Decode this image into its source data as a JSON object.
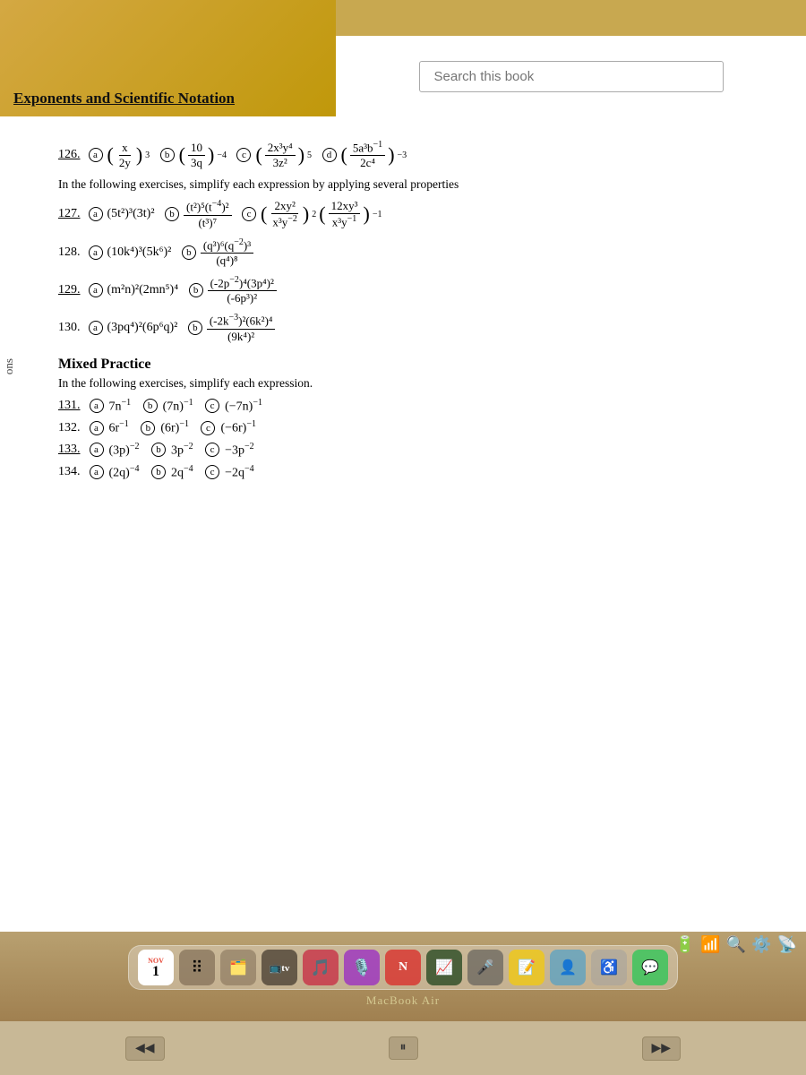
{
  "header": {
    "title": "Exponents and Scientific Notation",
    "search_placeholder": "Search this book"
  },
  "problem_126": {
    "number": "126.",
    "parts": {
      "a": "(x/2y)³",
      "b": "(10/3q)⁻⁴",
      "c": "(2x³y⁴/3z²)⁵",
      "d": "(5a³b⁻¹/2c⁴)⁻³"
    }
  },
  "instruction_1": "In the following exercises, simplify each expression by applying several properties",
  "problem_127": {
    "number": "127.",
    "parts": {
      "a": "(5t²)³(3t)²",
      "b": "(t²)⁵(t⁻⁴)² / (t³)⁷",
      "c": "(2xy²/x³y⁻²)² · (12xy³/x³y⁻¹)⁻¹"
    }
  },
  "problem_128": {
    "number": "128.",
    "parts": {
      "a": "(10k⁴)³(5k⁶)²",
      "b": "(q³)⁶(q⁻²)³ / (q⁴)⁸"
    }
  },
  "problem_129": {
    "number": "129.",
    "parts": {
      "a": "(m²n)²(2mn⁵)⁴",
      "b": "(-2p⁻²)⁴(3p⁴)² / (-6p³)²"
    }
  },
  "problem_130": {
    "number": "130.",
    "parts": {
      "a": "(3pq⁴)²(6p⁶q)²",
      "b": "(-2k⁻³)²(6k²)⁴ / (9k⁴)²"
    }
  },
  "mixed_practice": {
    "title": "Mixed Practice",
    "instruction": "In the following exercises, simplify each expression."
  },
  "problem_131": {
    "number": "131.",
    "parts": {
      "a": "7n⁻¹",
      "b": "(7n)⁻¹",
      "c": "(-7n)⁻¹"
    }
  },
  "problem_132": {
    "number": "132.",
    "parts": {
      "a": "6r⁻¹",
      "b": "(6r)⁻¹",
      "c": "(-6r)⁻¹"
    }
  },
  "problem_133": {
    "number": "133.",
    "parts": {
      "a": "(3p)⁻²",
      "b": "3p⁻²",
      "c": "−3p⁻²"
    }
  },
  "problem_134": {
    "number": "134.",
    "parts": {
      "a": "(2q)⁻⁴",
      "b": "2q⁻⁴",
      "c": "−2q⁻⁴"
    }
  },
  "dock": {
    "date_month": "NOV",
    "date_day": "1",
    "macbook_label": "MacBook Air"
  },
  "left_sidebar_label": "ons"
}
